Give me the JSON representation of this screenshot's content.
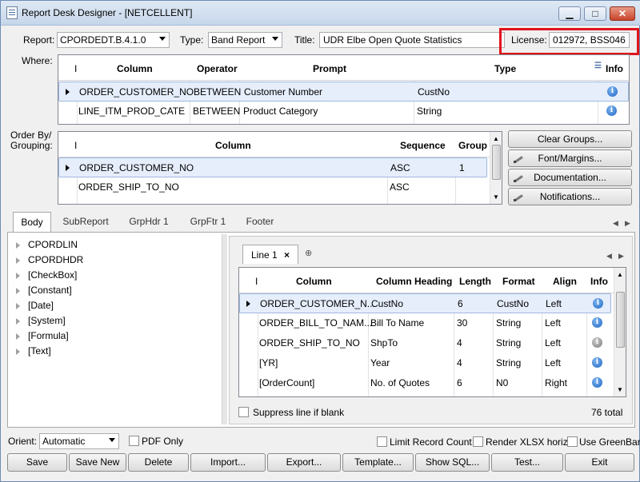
{
  "window": {
    "title": "Report Desk Designer - [NETCELLENT]"
  },
  "report": {
    "report_label": "Report:",
    "report_value": "CPORDEDT.B.4.1.0",
    "type_label": "Type:",
    "type_value": "Band Report",
    "title_label": "Title:",
    "title_value": "UDR Elbe Open Quote Statistics",
    "license_label": "License:",
    "license_value": "012972, BSS046"
  },
  "where": {
    "label": "Where:",
    "headers": [
      "Column",
      "Operator",
      "Prompt",
      "Type",
      "Info"
    ],
    "rows": [
      {
        "column": "ORDER_CUSTOMER_NO",
        "operator": "BETWEEN",
        "prompt": "Customer Number",
        "type": "CustNo"
      },
      {
        "column": "LINE_ITM_PROD_CATE",
        "operator": "BETWEEN",
        "prompt": "Product Category",
        "type": "String"
      }
    ]
  },
  "order_by": {
    "label_line1": "Order By/",
    "label_line2": "Grouping:",
    "headers": [
      "Column",
      "Sequence",
      "Group"
    ],
    "rows": [
      {
        "column": "ORDER_CUSTOMER_NO",
        "sequence": "ASC",
        "group": "1"
      },
      {
        "column": "ORDER_SHIP_TO_NO",
        "sequence": "ASC",
        "group": ""
      }
    ]
  },
  "side_buttons": {
    "clear_groups": "Clear Groups...",
    "font_margins": "Font/Margins...",
    "documentation": "Documentation...",
    "notifications": "Notifications..."
  },
  "tabs": [
    "Body",
    "SubReport",
    "GrpHdr 1",
    "GrpFtr 1",
    "Footer"
  ],
  "tree": [
    "CPORDLIN",
    "CPORDHDR",
    "[CheckBox]",
    "[Constant]",
    "[Date]",
    "[System]",
    "[Formula]",
    "[Text]"
  ],
  "line_tab": {
    "label": "Line 1",
    "close": "×"
  },
  "line_grid": {
    "headers": [
      "Column",
      "Column Heading",
      "Length",
      "Format",
      "Align",
      "Info"
    ],
    "rows": [
      {
        "column": "ORDER_CUSTOMER_N...",
        "heading": "CustNo",
        "length": "6",
        "format": "CustNo",
        "align": "Left",
        "info": "blue"
      },
      {
        "column": "ORDER_BILL_TO_NAM...",
        "heading": "Bill To Name",
        "length": "30",
        "format": "String",
        "align": "Left",
        "info": "blue"
      },
      {
        "column": "ORDER_SHIP_TO_NO",
        "heading": "ShpTo",
        "length": "4",
        "format": "String",
        "align": "Left",
        "info": "grey"
      },
      {
        "column": "[YR]",
        "heading": "Year",
        "length": "4",
        "format": "String",
        "align": "Left",
        "info": "blue"
      },
      {
        "column": "[OrderCount]",
        "heading": "No. of Quotes",
        "length": "6",
        "format": "N0",
        "align": "Right",
        "info": "blue"
      }
    ]
  },
  "suppress_label": "Suppress line if blank",
  "total_label": "76 total",
  "bottom": {
    "orient_label": "Orient:",
    "orient_value": "Automatic",
    "pdf_only": "PDF Only",
    "limit_record_count": "Limit Record Count",
    "render_xlsx": "Render XLSX horiz.",
    "use_greenbar": "Use GreenBar"
  },
  "actions": [
    "Save",
    "Save New",
    "Delete",
    "Import...",
    "Export...",
    "Template...",
    "Show SQL...",
    "Test...",
    "Exit"
  ],
  "colors": {
    "highlight_box": "#e0141c",
    "selection": "#e6eefb",
    "title_gradient": "#c6d6ea"
  }
}
